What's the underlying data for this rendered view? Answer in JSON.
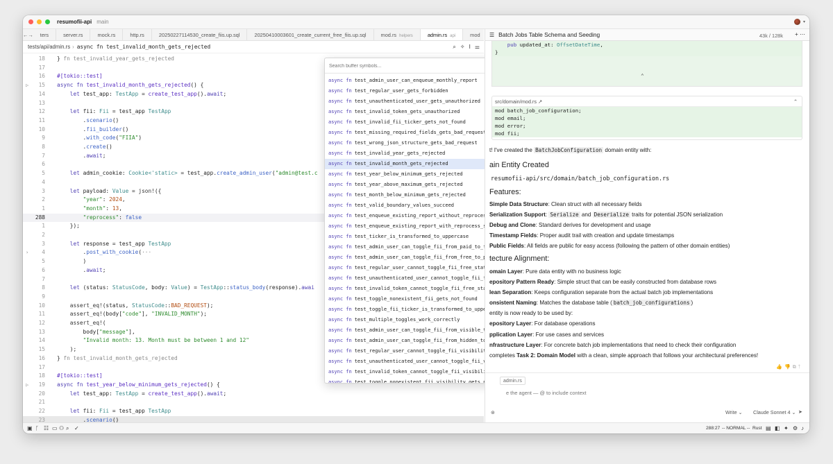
{
  "window": {
    "project": "resumofii-api",
    "branch": "main"
  },
  "tabs": [
    {
      "label": "ters",
      "hint": ""
    },
    {
      "label": "server.rs",
      "hint": ""
    },
    {
      "label": "mock.rs",
      "hint": ""
    },
    {
      "label": "http.rs",
      "hint": ""
    },
    {
      "label": "20250227114530_create_fiis.up.sql",
      "hint": ""
    },
    {
      "label": "20250410003601_create_current_free_fiis.up.sql",
      "hint": ""
    },
    {
      "label": "mod.rs",
      "hint": "helpers"
    },
    {
      "label": "admin.rs",
      "hint": "api"
    },
    {
      "label": "mod",
      "hint": ""
    }
  ],
  "breadcrumb": {
    "path": "tests/api/admin.rs",
    "sep": "›",
    "fn": "async fn test_invalid_month_gets_rejected"
  },
  "editor": {
    "lines": [
      {
        "n": "18",
        "g": "",
        "h": "<span class='code'>} <span class='cm'>fn test_invalid_year_gets_rejected</span></span>"
      },
      {
        "n": "17",
        "g": "",
        "h": "<span class='code'></span>"
      },
      {
        "n": "16",
        "g": "",
        "h": "<span class='code'><span class='at'>#[tokio::test]</span></span>"
      },
      {
        "n": "15",
        "g": "▷",
        "h": "<span class='code'><span class='kw'>async fn</span> <span class='fnn'>test_invalid_month_gets_rejected</span>() {</span>"
      },
      {
        "n": "14",
        "g": "",
        "h": "<span class='code'>    <span class='kw'>let</span> test_app: <span class='ty'>TestApp</span> = <span class='fnn'>create_test_app</span>().<span class='kw'>await</span>;</span>"
      },
      {
        "n": "13",
        "g": "",
        "h": "<span class='code'></span>"
      },
      {
        "n": "12",
        "g": "",
        "h": "<span class='code'>    <span class='kw'>let</span> fii: <span class='ty'>Fii</span> = test_app <span class='ty'>TestApp</span></span>"
      },
      {
        "n": "11",
        "g": "",
        "h": "<span class='code'>        .<span class='mt'>scenario</span>()</span>"
      },
      {
        "n": "10",
        "g": "",
        "h": "<span class='code'>        .<span class='mt'>fii_builder</span>()</span>"
      },
      {
        "n": "9",
        "g": "",
        "h": "<span class='code'>        .<span class='mt'>with_code</span>(<span class='st'>\"FIIA\"</span>)</span>"
      },
      {
        "n": "8",
        "g": "",
        "h": "<span class='code'>        .<span class='mt'>create</span>()</span>"
      },
      {
        "n": "7",
        "g": "",
        "h": "<span class='code'>        .<span class='kw'>await</span>;</span>"
      },
      {
        "n": "6",
        "g": "",
        "h": "<span class='code'></span>"
      },
      {
        "n": "5",
        "g": "",
        "h": "<span class='code'>    <span class='kw'>let</span> admin_cookie: <span class='ty'>Cookie&lt;'static&gt;</span> = test_app.<span class='mt'>create_admin_user</span>(<span class='st'>\"admin@test.c</span></span>"
      },
      {
        "n": "4",
        "g": "",
        "h": "<span class='code'></span>"
      },
      {
        "n": "3",
        "g": "",
        "h": "<span class='code'>    <span class='kw'>let</span> payload: <span class='ty'>Value</span> = <span class='mc'>json!</span>({</span>"
      },
      {
        "n": "2",
        "g": "",
        "h": "<span class='code'>        <span class='st'>\"year\"</span>: <span class='nm'>2024</span>,</span>"
      },
      {
        "n": "1",
        "g": "",
        "h": "<span class='code'>        <span class='st'>\"month\"</span>: <span class='nm'>13</span>,</span>"
      },
      {
        "n": "288",
        "g": "",
        "h": "<span class='code'>        <span class='st'>\"reprocess\"</span>: <span class='mt'>false</span></span>",
        "cls": "cur"
      },
      {
        "n": "1",
        "g": "",
        "h": "<span class='code'>    });</span>"
      },
      {
        "n": "2",
        "g": "",
        "h": "<span class='code'></span>"
      },
      {
        "n": "3",
        "g": "",
        "h": "<span class='code'>    <span class='kw'>let</span> response = test_app <span class='ty'>TestApp</span></span>"
      },
      {
        "n": "4",
        "g": "›",
        "h": "<span class='code'>        .<span class='mt'>post_with_cookie</span>(<span class='cm'>···</span></span>"
      },
      {
        "n": "5",
        "g": "",
        "h": "<span class='code'>        )</span>"
      },
      {
        "n": "6",
        "g": "",
        "h": "<span class='code'>        .<span class='kw'>await</span>;</span>"
      },
      {
        "n": "7",
        "g": "",
        "h": "<span class='code'></span>"
      },
      {
        "n": "8",
        "g": "",
        "h": "<span class='code'>    <span class='kw'>let</span> (status: <span class='ty'>StatusCode</span>, body: <span class='ty'>Value</span>) = <span class='ty'>TestApp</span>::<span class='mt'>status_body</span>(response).<span class='kw'>awai</span></span>"
      },
      {
        "n": "9",
        "g": "",
        "h": "<span class='code'></span>"
      },
      {
        "n": "10",
        "g": "",
        "h": "<span class='code'>    <span class='mc'>assert_eq!</span>(status, <span class='ty'>StatusCode</span>::<span class='nm'>BAD_REQUEST</span>);</span>"
      },
      {
        "n": "11",
        "g": "",
        "h": "<span class='code'>    <span class='mc'>assert_eq!</span>(body[<span class='st'>\"code\"</span>], <span class='st'>\"INVALID_MONTH\"</span>);</span>"
      },
      {
        "n": "12",
        "g": "",
        "h": "<span class='code'>    <span class='mc'>assert_eq!</span>(</span>"
      },
      {
        "n": "13",
        "g": "",
        "h": "<span class='code'>        body[<span class='st'>\"message\"</span>],</span>"
      },
      {
        "n": "14",
        "g": "",
        "h": "<span class='code'>        <span class='st'>\"Invalid month: 13. Month must be between 1 and 12\"</span></span>"
      },
      {
        "n": "15",
        "g": "",
        "h": "<span class='code'>    );</span>"
      },
      {
        "n": "16",
        "g": "",
        "h": "<span class='code'>} <span class='cm'>fn test_invalid_month_gets_rejected</span></span>"
      },
      {
        "n": "17",
        "g": "",
        "h": "<span class='code'></span>"
      },
      {
        "n": "18",
        "g": "",
        "h": "<span class='code'><span class='at'>#[tokio::test]</span></span>"
      },
      {
        "n": "19",
        "g": "▷",
        "h": "<span class='code'><span class='kw'>async fn</span> <span class='fnn'>test_year_below_minimum_gets_rejected</span>() {</span>"
      },
      {
        "n": "20",
        "g": "",
        "h": "<span class='code'>    <span class='kw'>let</span> test_app: <span class='ty'>TestApp</span> = <span class='fnn'>create_test_app</span>().<span class='kw'>await</span>;</span>"
      },
      {
        "n": "21",
        "g": "",
        "h": "<span class='code'></span>"
      },
      {
        "n": "22",
        "g": "",
        "h": "<span class='code'>    <span class='kw'>let</span> fii: <span class='ty'>Fii</span> = test_app <span class='ty'>TestApp</span></span>"
      },
      {
        "n": "23",
        "g": "",
        "h": "<span class='code'>        .<span class='mt'>scenario</span>()</span>",
        "cls": "sel"
      }
    ]
  },
  "palette": {
    "placeholder": "Search buffer symbols...",
    "items": [
      "test_admin_user_can_enqueue_monthly_report",
      "test_regular_user_gets_forbidden",
      "test_unauthenticated_user_gets_unauthorized",
      "test_invalid_token_gets_unauthorized",
      "test_invalid_fii_ticker_gets_not_found",
      "test_missing_required_fields_gets_bad_request",
      "test_wrong_json_structure_gets_bad_request",
      "test_invalid_year_gets_rejected",
      "test_invalid_month_gets_rejected",
      "test_year_below_minimum_gets_rejected",
      "test_year_above_maximum_gets_rejected",
      "test_month_below_minimum_gets_rejected",
      "test_valid_boundary_values_succeed",
      "test_enqueue_existing_report_without_reprocess_fails",
      "test_enqueue_existing_report_with_reprocess_succeeds",
      "test_ticker_is_transformed_to_uppercase",
      "test_admin_user_can_toggle_fii_from_paid_to_free",
      "test_admin_user_can_toggle_fii_from_free_to_paid",
      "test_regular_user_cannot_toggle_fii_free_status",
      "test_unauthenticated_user_cannot_toggle_fii_free_status",
      "test_invalid_token_cannot_toggle_fii_free_status",
      "test_toggle_nonexistent_fii_gets_not_found",
      "test_toggle_fii_ticker_is_transformed_to_uppercase",
      "test_multiple_toggles_work_correctly",
      "test_admin_user_can_toggle_fii_from_visible_to_hidden",
      "test_admin_user_can_toggle_fii_from_hidden_to_visible",
      "test_regular_user_cannot_toggle_fii_visibility",
      "test_unauthenticated_user_cannot_toggle_fii_visibility",
      "test_invalid_token_cannot_toggle_fii_visibility",
      "test_toggle_nonexistent_fii_visibility_gets_not_found"
    ],
    "selected": 8,
    "kw": "async fn"
  },
  "agent": {
    "thread_title": "Batch Jobs Table Schema and Seeding",
    "context": "43k / 128k",
    "block1": {
      "lines": [
        "    pub updated_at: OffsetDateTime,",
        "}"
      ]
    },
    "block2": {
      "file": "src/domain/mod.rs",
      "lines": [
        "mod batch_job_configuration;",
        "mod email;",
        "mod error;",
        "mod fii;"
      ]
    },
    "messages": [
      {
        "t": "t!  I've created the <span class='ic'>BatchJobConfiguration</span> domain entity with:",
        "cls": ""
      },
      {
        "t": "ain Entity Created",
        "cls": "h"
      },
      {
        "t": "<span class='ic' style='background:none;font-size:8.4px'>resumofii-api/src/domain/batch_job_configuration.rs</span>",
        "cls": ""
      },
      {
        "t": "Features:",
        "cls": "h"
      },
      {
        "t": "<b>Simple Data Structure</b>: Clean struct with all necessary fields",
        "cls": ""
      },
      {
        "t": "<b>Serialization Support</b>: <span class='ic'>Serialize</span> and <span class='ic'>Deserialize</span> traits for potential JSON serialization",
        "cls": ""
      },
      {
        "t": "<b>Debug and Clone</b>: Standard derives for development and usage",
        "cls": ""
      },
      {
        "t": "<b>Timestamp Fields</b>: Proper audit trail with creation and update timestamps",
        "cls": ""
      },
      {
        "t": "<b>Public Fields</b>: All fields are public for easy access (following the pattern of other domain entities)",
        "cls": ""
      },
      {
        "t": "tecture Alignment:",
        "cls": "h"
      },
      {
        "t": "<b>omain Layer</b>: Pure data entity with no business logic",
        "cls": ""
      },
      {
        "t": "<b>epository Pattern Ready</b>: Simple struct that can be easily constructed from database rows",
        "cls": ""
      },
      {
        "t": "<b>lean Separation</b>: Keeps configuration separate from the actual batch job implementations",
        "cls": ""
      },
      {
        "t": "<b>onsistent Naming</b>: Matches the database table (<span class='ic'>batch_job_configurations</span>)",
        "cls": ""
      },
      {
        "t": "entity is now ready to be used by:",
        "cls": ""
      },
      {
        "t": "<b>epository Layer</b>: For database operations",
        "cls": ""
      },
      {
        "t": "<b>pplication Layer</b>: For use cases and services",
        "cls": ""
      },
      {
        "t": "<b>nfrastructure Layer</b>: For concrete batch job implementations that need to check their configuration",
        "cls": ""
      },
      {
        "t": "completes <b>Task 2: Domain Model</b> with a clean, simple approach that follows your architectural preferences!",
        "cls": ""
      }
    ],
    "input_context": "admin.rs",
    "input_placeholder": "e the agent — @ to include context",
    "mode": "Write",
    "model": "Claude Sonnet 4"
  },
  "status": {
    "position": "288:27",
    "mode": "-- NORMAL --",
    "lang": "Rust"
  }
}
